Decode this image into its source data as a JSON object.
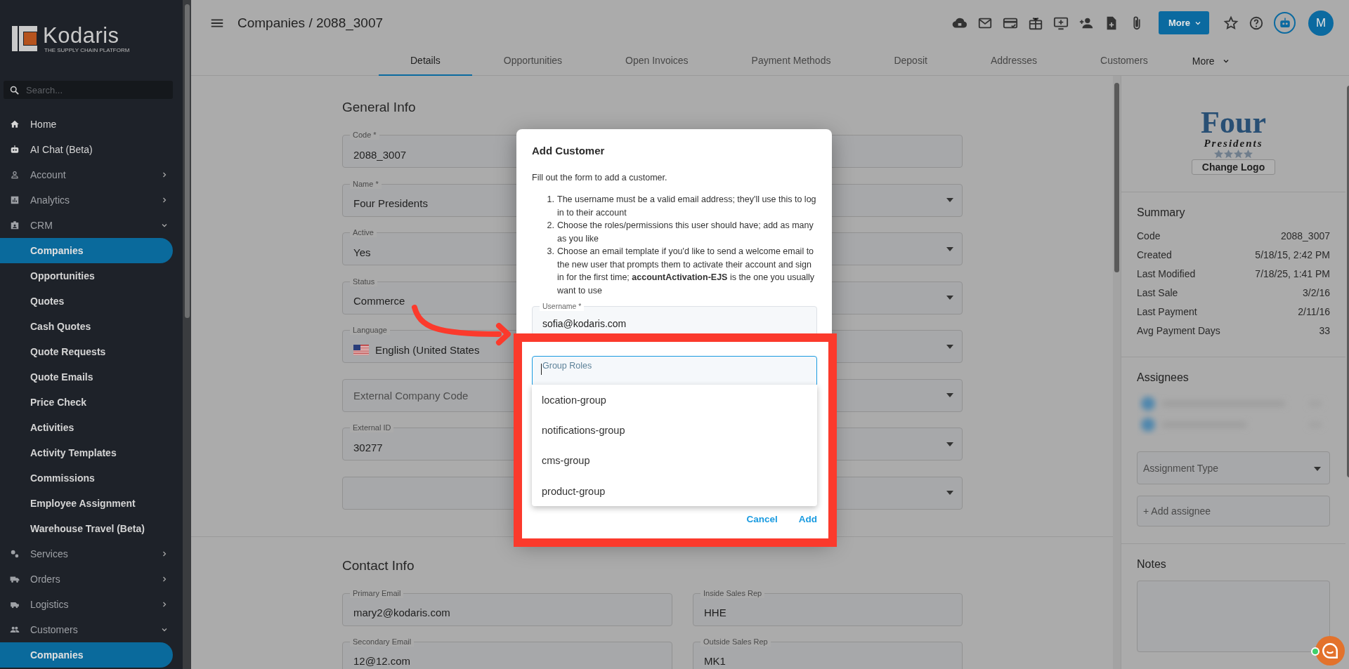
{
  "sidebar": {
    "logo": {
      "name": "Kodaris",
      "tagline": "THE SUPPLY CHAIN PLATFORM"
    },
    "search": {
      "placeholder": "Search..."
    },
    "items": [
      {
        "label": "Home",
        "selected": false
      },
      {
        "label": "AI Chat (Beta)",
        "selected": false
      },
      {
        "label": "Account",
        "selected": false,
        "expanded": false
      },
      {
        "label": "Analytics",
        "selected": false,
        "expanded": false
      },
      {
        "label": "CRM",
        "selected": false,
        "expanded": true,
        "children": [
          {
            "label": "Companies",
            "selected": true
          },
          {
            "label": "Opportunities",
            "selected": false
          },
          {
            "label": "Quotes",
            "selected": false
          },
          {
            "label": "Cash Quotes",
            "selected": false
          },
          {
            "label": "Quote Requests",
            "selected": false
          },
          {
            "label": "Quote Emails",
            "selected": false
          },
          {
            "label": "Price Check",
            "selected": false
          },
          {
            "label": "Activities",
            "selected": false
          },
          {
            "label": "Activity Templates",
            "selected": false
          },
          {
            "label": "Commissions",
            "selected": false
          },
          {
            "label": "Employee Assignment",
            "selected": false
          },
          {
            "label": "Warehouse Travel (Beta)",
            "selected": false
          }
        ]
      },
      {
        "label": "Services",
        "selected": false,
        "expanded": false
      },
      {
        "label": "Orders",
        "selected": false,
        "expanded": false
      },
      {
        "label": "Logistics",
        "selected": false,
        "expanded": false
      },
      {
        "label": "Customers",
        "selected": false,
        "expanded": true,
        "children": [
          {
            "label": "Companies",
            "selected": true
          }
        ]
      }
    ]
  },
  "header": {
    "title": "Companies / 2088_3007",
    "more_button": "More",
    "avatar": "M"
  },
  "tabs": [
    {
      "label": "Details",
      "selected": true
    },
    {
      "label": "Opportunities",
      "selected": false
    },
    {
      "label": "Open Invoices",
      "selected": false
    },
    {
      "label": "Payment Methods",
      "selected": false
    },
    {
      "label": "Deposit",
      "selected": false
    },
    {
      "label": "Addresses",
      "selected": false
    },
    {
      "label": "Customers",
      "selected": false
    }
  ],
  "tabs_more": "More",
  "general_info": {
    "title": "General Info",
    "fields": [
      {
        "kind": "text",
        "label": "Code *",
        "value": "2088_3007"
      },
      {
        "kind": "select",
        "label": "Name *",
        "value": "Four Presidents"
      },
      {
        "kind": "select",
        "label": "Active",
        "value": "Yes"
      },
      {
        "kind": "select",
        "label": "Status",
        "value": "Commerce"
      },
      {
        "kind": "language",
        "label": "Language",
        "value": "English (United States"
      },
      {
        "kind": "select",
        "placeholder": "External Company Code"
      },
      {
        "kind": "select",
        "label": "External ID",
        "value": "30277"
      },
      {
        "kind": "select"
      }
    ]
  },
  "contact_info": {
    "title": "Contact Info",
    "fields": [
      {
        "kind": "text",
        "label": "Primary Email",
        "value": "mary2@kodaris.com"
      },
      {
        "kind": "text",
        "label": "Inside Sales Rep",
        "value": "HHE"
      },
      {
        "kind": "text",
        "label": "Secondary Email",
        "value": "12@12.com"
      },
      {
        "kind": "text",
        "label": "Outside Sales Rep",
        "value": "MK1"
      }
    ]
  },
  "side_panel": {
    "logo": {
      "line1": "Four",
      "line2": "Presidents"
    },
    "change_logo": "Change Logo",
    "summary": {
      "title": "Summary",
      "rows": [
        {
          "label": "Code",
          "value": "2088_3007"
        },
        {
          "label": "Created",
          "value": "5/18/15, 2:42 PM"
        },
        {
          "label": "Last Modified",
          "value": "7/18/25, 1:41 PM"
        },
        {
          "label": "Last Sale",
          "value": "3/2/16"
        },
        {
          "label": "Last Payment",
          "value": "2/11/16"
        },
        {
          "label": "Avg Payment Days",
          "value": "33"
        }
      ]
    },
    "assignees": {
      "title": "Assignees",
      "type_placeholder": "Assignment Type",
      "add_placeholder": "+ Add assignee"
    },
    "notes": {
      "title": "Notes"
    }
  },
  "dialog": {
    "title": "Add Customer",
    "intro": "Fill out the form to add a customer.",
    "steps": [
      {
        "number": "1.",
        "text": "The username must be a valid email address; they'll use this to log in to their account"
      },
      {
        "number": "2.",
        "text": "Choose the roles/permissions this user should have; add as many as you like"
      },
      {
        "number": "3.",
        "text": "Choose an email template if you'd like to send a welcome email to the new user that prompts them to activate their account and sign in for the first time; **accountActivation-EJS** is the one you usually want to use"
      }
    ],
    "username": {
      "label": "Username *",
      "value": "sofia@kodaris.com"
    },
    "group_roles": {
      "label": "Group Roles"
    },
    "options": [
      {
        "label": "location-group",
        "selected": false
      },
      {
        "label": "notifications-group",
        "selected": false
      },
      {
        "label": "cms-group",
        "selected": false
      },
      {
        "label": "product-group",
        "selected": false
      }
    ],
    "buttons": [
      {
        "label": "Cancel"
      },
      {
        "label": "Add"
      }
    ]
  }
}
